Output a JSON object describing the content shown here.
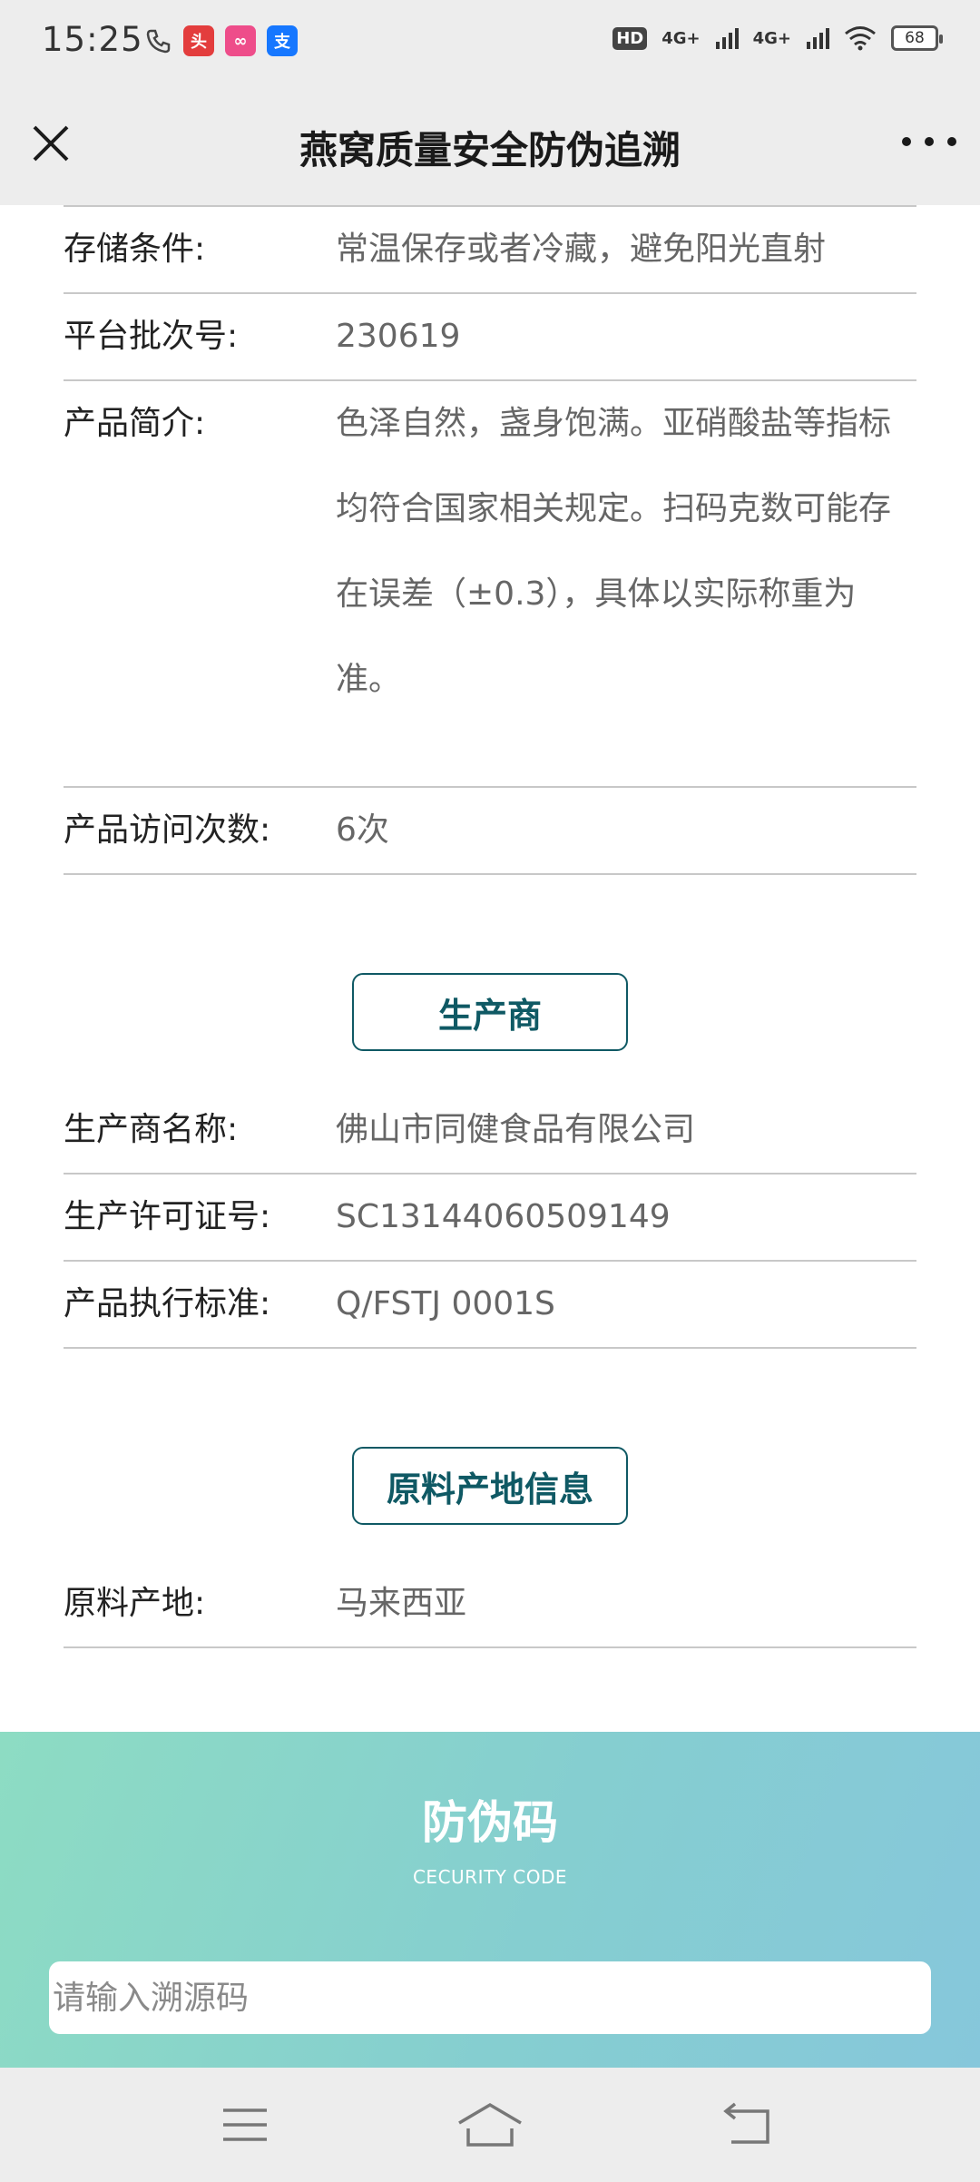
{
  "status_bar": {
    "time": "15:25",
    "left_icons": [
      "phone-icon",
      "toutiao-app-icon",
      "video-app-icon",
      "alipay-app-icon"
    ],
    "hd_label": "HD",
    "network_1": "4G+",
    "network_2": "4G+",
    "battery": "68"
  },
  "title_bar": {
    "title": "燕窝质量安全防伪追溯"
  },
  "product_info": [
    {
      "label": "存储条件:",
      "value": "常温保存或者冷藏，避免阳光直射"
    },
    {
      "label": "平台批次号:",
      "value": "230619"
    },
    {
      "label": "产品简介:",
      "value": "色泽自然，盏身饱满。亚硝酸盐等指标均符合国家相关规定。扫码克数可能存在误差（±0.3），具体以实际称重为准。"
    },
    {
      "label": "产品访问次数:",
      "value": "6次"
    }
  ],
  "manufacturer": {
    "section_title": "生产商",
    "rows": [
      {
        "label": "生产商名称:",
        "value": "佛山市同健食品有限公司"
      },
      {
        "label": "生产许可证号:",
        "value": "SC13144060509149"
      },
      {
        "label": "产品执行标准:",
        "value": "Q/FSTJ 0001S"
      }
    ]
  },
  "origin": {
    "section_title": "原料产地信息",
    "rows": [
      {
        "label": "原料产地:",
        "value": "马来西亚"
      }
    ]
  },
  "security_code": {
    "title": "防伪码",
    "subtitle": "CECURITY CODE",
    "input_placeholder": "请输入溯源码"
  },
  "colors": {
    "accent": "#0f5964",
    "gradient_start": "#8ddcc3",
    "gradient_end": "#86c7db"
  }
}
